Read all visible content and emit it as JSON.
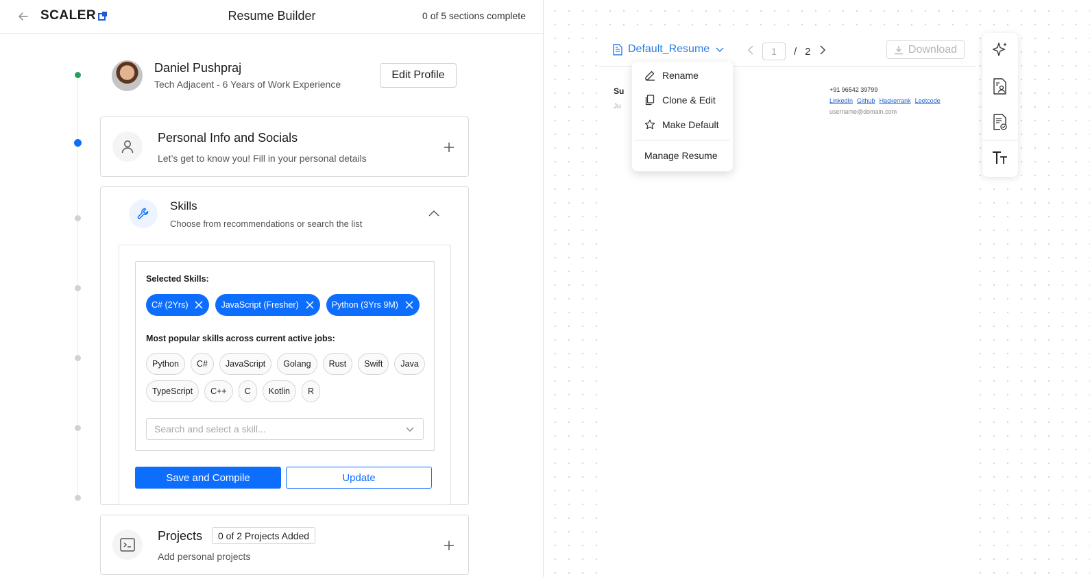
{
  "header": {
    "logo": "SCALER",
    "title": "Resume Builder",
    "progress": "0 of 5 sections complete"
  },
  "profile": {
    "name": "Daniel Pushpraj",
    "subtitle": "Tech Adjacent - 6 Years of Work Experience",
    "edit_label": "Edit Profile"
  },
  "personal": {
    "title": "Personal Info and Socials",
    "subtitle": "Let’s get to know you! Fill in your personal details"
  },
  "skills": {
    "title": "Skills",
    "subtitle": "Choose from recommendations or search the list",
    "selected_label": "Selected Skills:",
    "selected": [
      "C# (2Yrs)",
      "JavaScript (Fresher)",
      "Python (3Yrs 9M)"
    ],
    "popular_label": "Most popular skills across current active jobs:",
    "popular_row1": [
      "Python",
      "C#",
      "JavaScript",
      "Golang",
      "Rust",
      "Swift",
      "Java"
    ],
    "popular_row2": [
      "TypeScript",
      "C++",
      "C",
      "Kotlin",
      "R"
    ],
    "search_placeholder": "Search and select a skill...",
    "save_label": "Save and Compile",
    "update_label": "Update"
  },
  "projects": {
    "title": "Projects",
    "badge": "0 of 2 Projects Added",
    "subtitle": "Add personal projects"
  },
  "preview": {
    "doc_name": "Default_Resume",
    "current_page": "1",
    "separator": "/",
    "total_pages": "2",
    "download_label": "Download",
    "section_title": "Su",
    "section_sub": "Ju",
    "phone": "+91 96542 39799",
    "links": [
      "LinkedIn",
      "Github",
      "Hackerrank",
      "Leetcode"
    ],
    "email": "username@domain.com"
  },
  "menu": {
    "rename": "Rename",
    "clone": "Clone & Edit",
    "make_default": "Make Default",
    "manage": "Manage Resume"
  },
  "colors": {
    "accent": "#0d6efd",
    "link": "#2a7de1",
    "complete": "#1fa35a"
  },
  "icons": {
    "toolbar": [
      "sparkle-icon",
      "resume-user-icon",
      "resume-check-icon",
      "text-size-icon"
    ]
  }
}
